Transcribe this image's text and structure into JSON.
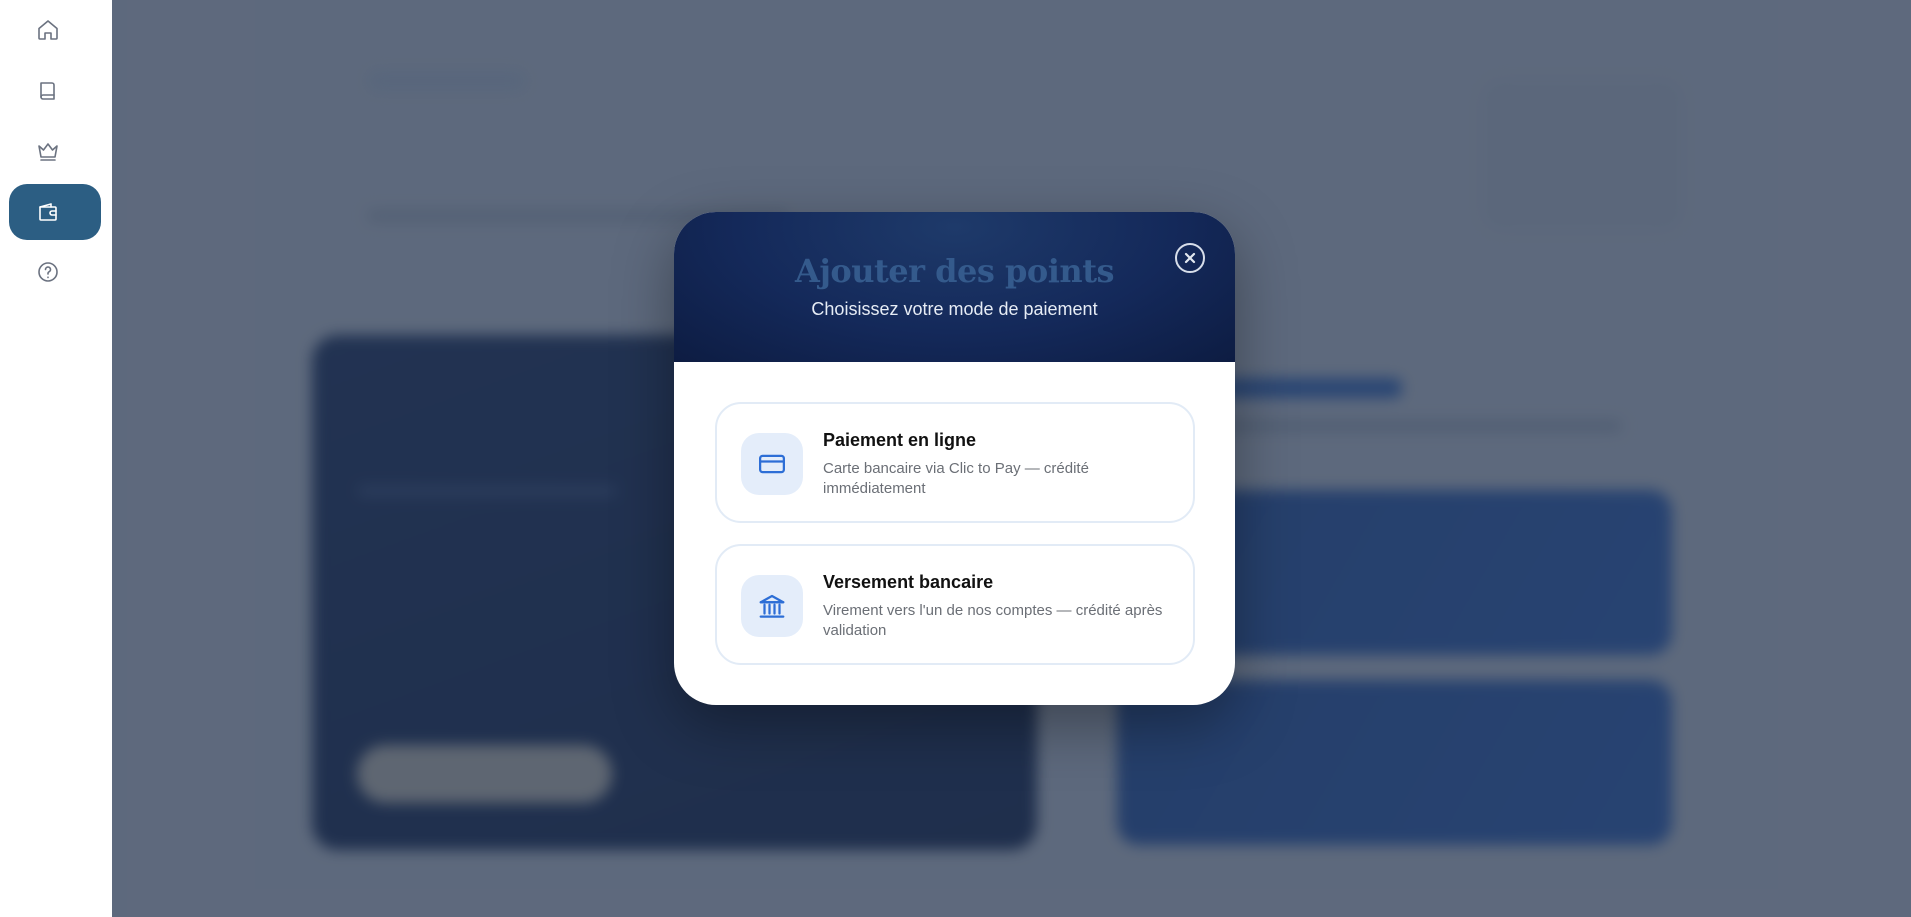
{
  "sidebar": {
    "items": [
      {
        "id": "home",
        "icon": "home-icon",
        "active": false
      },
      {
        "id": "book",
        "icon": "book-icon",
        "active": false
      },
      {
        "id": "crown",
        "icon": "crown-icon",
        "active": false
      },
      {
        "id": "wallet",
        "icon": "wallet-icon",
        "active": true
      },
      {
        "id": "help",
        "icon": "help-circle-icon",
        "active": false
      }
    ],
    "active_color": "#2c5e83"
  },
  "modal": {
    "title": "Ajouter des points",
    "subtitle": "Choisissez votre mode de paiement",
    "close_icon": "close-icon",
    "options": [
      {
        "icon": "credit-card-icon",
        "title": "Paiement en ligne",
        "description": "Carte bancaire via Clic to Pay — crédité immédiatement"
      },
      {
        "icon": "bank-icon",
        "title": "Versement bancaire",
        "description": "Virement vers l'un de nos comptes — crédité après validation"
      }
    ]
  },
  "colors": {
    "header_dark": "#14295a",
    "accent_blue": "#2d6ed6",
    "title_blue": "#345a8c"
  }
}
